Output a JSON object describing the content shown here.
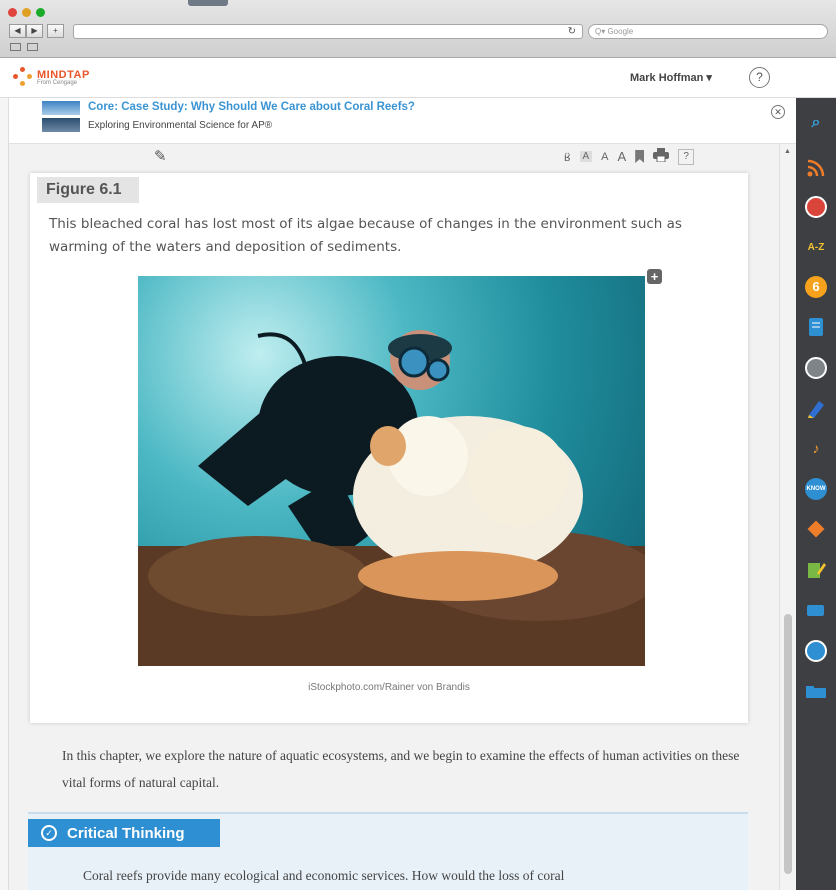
{
  "browser": {
    "search_placeholder": "Q▾ Google",
    "reload_glyph": "↻",
    "nav_back": "◀",
    "nav_forward": "▶",
    "nav_add": "+"
  },
  "app": {
    "logo_name": "MINDTAP",
    "logo_sub": "From Cengage",
    "user_name": "Mark Hoffman ▾",
    "help_label": "?"
  },
  "title": {
    "main": "Core: Case Study: Why Should We Care about Coral Reefs?",
    "sub": "Exploring Environmental Science for AP®",
    "close_label": "✕"
  },
  "toolbar": {
    "font_small": "A",
    "font_medium": "A",
    "font_large": "A",
    "help": "?"
  },
  "figure": {
    "label": "Figure 6.1",
    "caption": "This bleached coral has lost most of its algae because of changes in the environment such as warming of the waters and deposition of sediments.",
    "expand": "+",
    "credit": "iStockphoto.com/Rainer von Brandis"
  },
  "body_text": "In this chapter, we explore the nature of aquatic ecosystems, and we begin to examine the effects of human activities on these vital forms of natural capital.",
  "critical_thinking": {
    "label": "Critical Thinking",
    "text": "Coral reefs provide many ecological and economic services. How would the loss of coral"
  },
  "dock": {
    "icons": [
      "search-icon",
      "rss-icon",
      "news-icon",
      "glossary-icon",
      "flashcards-icon",
      "ebook-icon",
      "profile-icon",
      "highlighter-icon",
      "speech-icon",
      "know-icon",
      "diamond-icon",
      "notes-icon",
      "chat-icon",
      "clock-icon",
      "folder-icon"
    ],
    "text_glyphs": {
      "glossary": "A-Z",
      "flashcards": "6",
      "know": "KNOW",
      "speech": "♪"
    },
    "colors": {
      "search": "#3aa0dc",
      "rss": "#f07c2a",
      "news": "#d9443b",
      "glossary": "#f2c230",
      "flashcards": "#f6a21c",
      "ebook": "#2f8fd3",
      "profile": "#7f8488",
      "highlighter": "#2f6fd3",
      "speech": "#f0a030",
      "know": "#2f8fd3",
      "diamond": "#ef7d2a",
      "notes": "#79b844",
      "chat": "#2f8fd3",
      "clock": "#2f8fd3",
      "folder": "#2f8fd3"
    }
  },
  "colors": {
    "accent_blue": "#2f8fd3",
    "brand_orange": "#e8562a",
    "title_blue": "#3a94d3"
  }
}
